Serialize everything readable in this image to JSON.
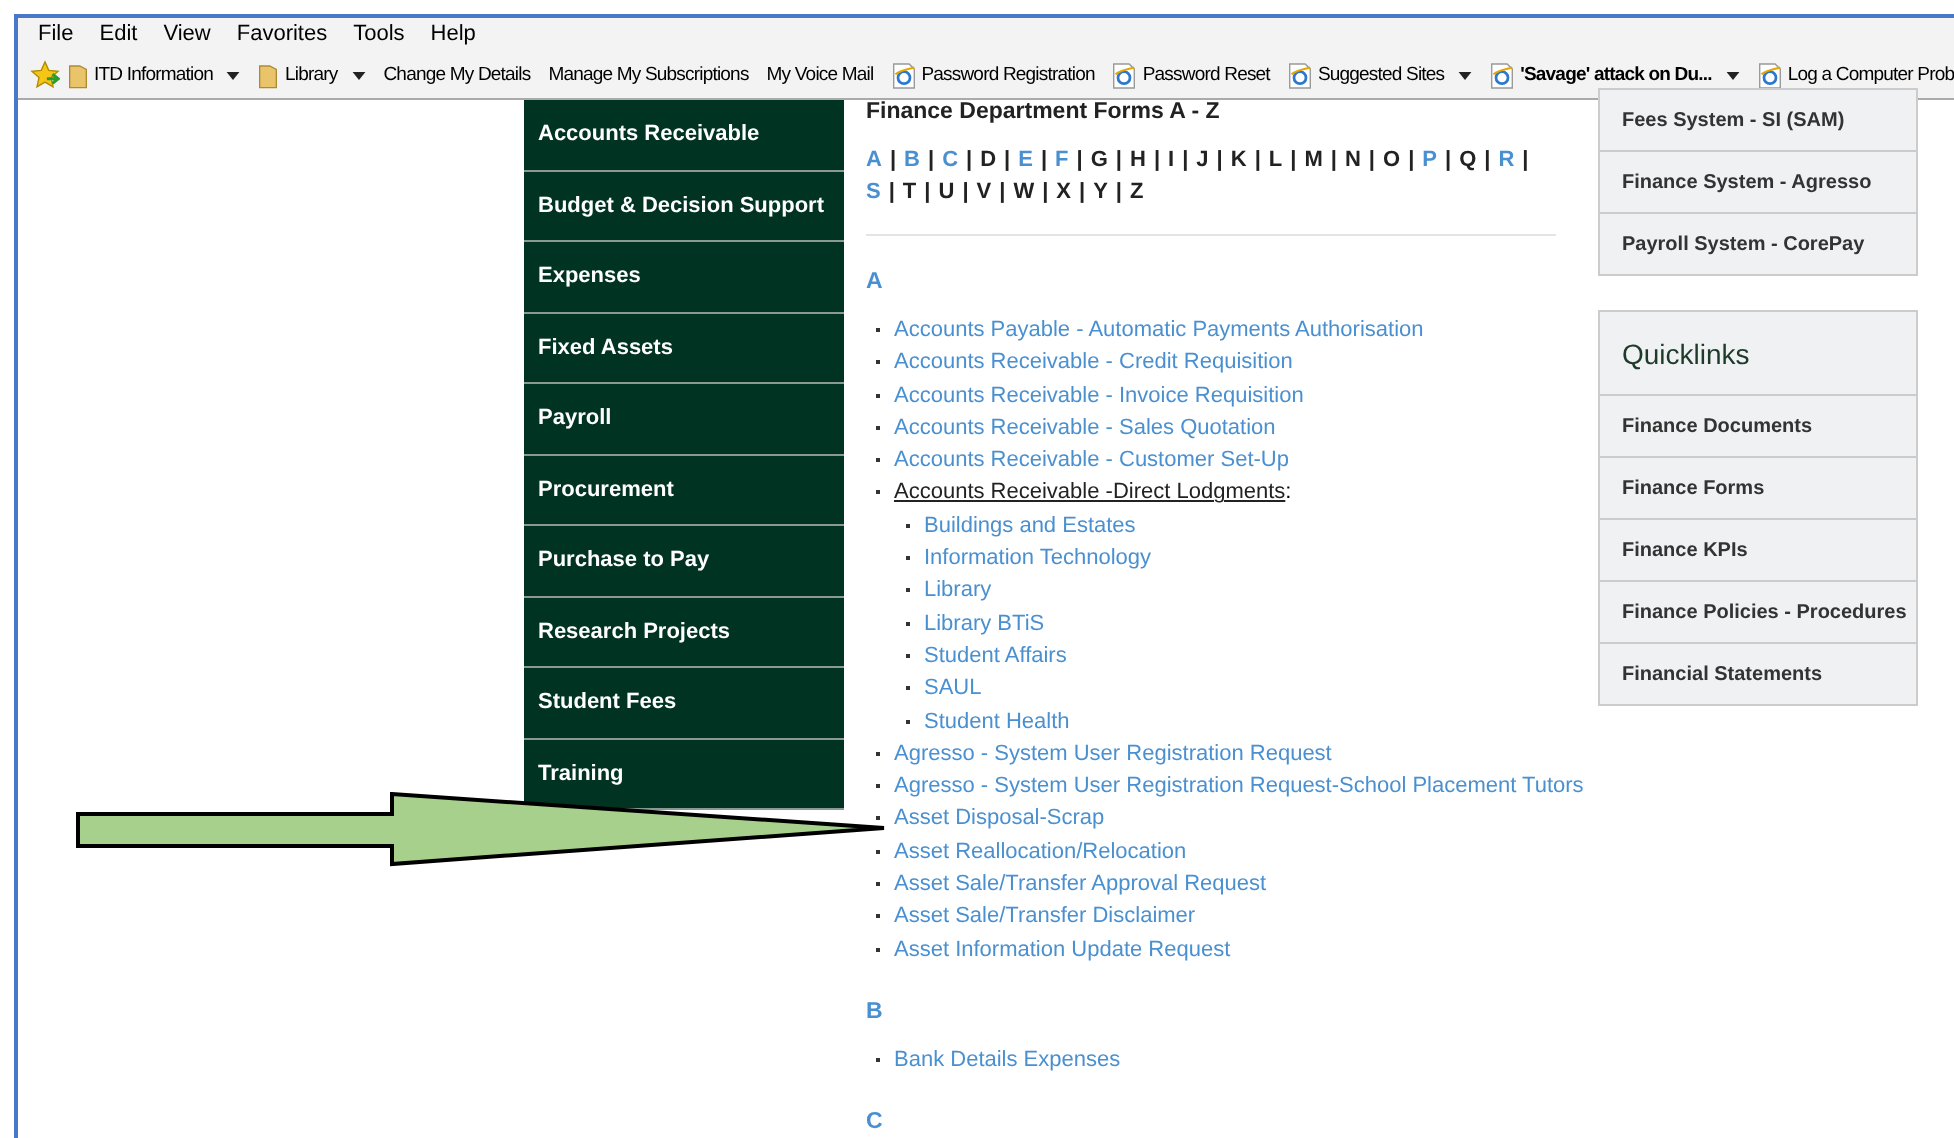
{
  "menu_bar": [
    "File",
    "Edit",
    "View",
    "Favorites",
    "Tools",
    "Help"
  ],
  "favorites_bar": [
    {
      "kind": "folder",
      "label": "ITD Information",
      "dropdown": true,
      "bold": false
    },
    {
      "kind": "folder",
      "label": "Library",
      "dropdown": true,
      "bold": false
    },
    {
      "kind": "plain",
      "label": "Change My Details",
      "dropdown": false,
      "bold": false
    },
    {
      "kind": "plain",
      "label": "Manage My Subscriptions",
      "dropdown": false,
      "bold": false
    },
    {
      "kind": "plain",
      "label": "My Voice Mail",
      "dropdown": false,
      "bold": false
    },
    {
      "kind": "page",
      "label": "Password Registration",
      "dropdown": false,
      "bold": false
    },
    {
      "kind": "page",
      "label": "Password Reset",
      "dropdown": false,
      "bold": false
    },
    {
      "kind": "page",
      "label": "Suggested Sites",
      "dropdown": true,
      "bold": false
    },
    {
      "kind": "page",
      "label": "'Savage' attack on Du...",
      "dropdown": true,
      "bold": true
    },
    {
      "kind": "page",
      "label": "Log a Computer Prob",
      "dropdown": false,
      "bold": false
    }
  ],
  "side_nav": [
    "Accounts Receivable",
    "Budget & Decision Support",
    "Expenses",
    "Fixed Assets",
    "Payroll",
    "Procurement",
    "Purchase to Pay",
    "Research Projects",
    "Student Fees",
    "Training"
  ],
  "content": {
    "heading": "Finance Department Forms A - Z",
    "alphabet": [
      {
        "letter": "A",
        "linked": true,
        "separator": "|"
      },
      {
        "letter": "B",
        "linked": true,
        "separator": "|"
      },
      {
        "letter": "C",
        "linked": true,
        "separator": "|"
      },
      {
        "letter": "D",
        "linked": false,
        "separator": "|"
      },
      {
        "letter": "E",
        "linked": true,
        "separator": "|"
      },
      {
        "letter": "F",
        "linked": true,
        "separator": "|"
      },
      {
        "letter": "G",
        "linked": false,
        "separator": "|"
      },
      {
        "letter": "H",
        "linked": false,
        "separator": "|"
      },
      {
        "letter": "I",
        "linked": false,
        "separator": "|"
      },
      {
        "letter": "J",
        "linked": false,
        "separator": "|"
      },
      {
        "letter": "K",
        "linked": false,
        "separator": "|"
      },
      {
        "letter": "L",
        "linked": false,
        "separator": "|"
      },
      {
        "letter": "M",
        "linked": false,
        "separator": "|"
      },
      {
        "letter": "N",
        "linked": false,
        "separator": "|"
      },
      {
        "letter": "O",
        "linked": false,
        "separator": "|"
      },
      {
        "letter": "P",
        "linked": true,
        "separator": "|"
      },
      {
        "letter": "Q",
        "linked": false,
        "separator": "|"
      },
      {
        "letter": "R",
        "linked": true,
        "separator": "|"
      },
      {
        "letter": "S",
        "linked": true,
        "separator": "|"
      },
      {
        "letter": "T",
        "linked": false,
        "separator": "|"
      },
      {
        "letter": "U",
        "linked": false,
        "separator": "|"
      },
      {
        "letter": "V",
        "linked": false,
        "separator": "|"
      },
      {
        "letter": "W",
        "linked": false,
        "separator": "|"
      },
      {
        "letter": "X",
        "linked": false,
        "separator": "|"
      },
      {
        "letter": "Y",
        "linked": false,
        "separator": "|"
      },
      {
        "letter": "Z",
        "linked": false
      }
    ],
    "sections": [
      {
        "letter": "A",
        "items": [
          {
            "label": "Accounts Payable - Automatic Payments Authorisation",
            "linked": true
          },
          {
            "label": "Accounts Receivable - Credit Requisition",
            "linked": true
          },
          {
            "label": "Accounts Receivable - Invoice Requisition",
            "linked": true
          },
          {
            "label": "Accounts Receivable - Sales Quotation",
            "linked": true
          },
          {
            "label": "Accounts Receivable - Customer Set-Up",
            "linked": true
          },
          {
            "label": "Accounts Receivable -Direct Lodgments",
            "linked": false,
            "suffix": ":",
            "children": [
              {
                "label": "Buildings and Estates",
                "linked": true
              },
              {
                "label": "Information Technology",
                "linked": true
              },
              {
                "label": "Library",
                "linked": true
              },
              {
                "label": "Library BTiS",
                "linked": true
              },
              {
                "label": "Student Affairs",
                "linked": true
              },
              {
                "label": "SAUL",
                "linked": true
              },
              {
                "label": "Student Health",
                "linked": true
              }
            ]
          },
          {
            "label": "Agresso - System User Registration Request",
            "linked": true
          },
          {
            "label": "Agresso - System User Registration Request-School Placement Tutors",
            "linked": true
          },
          {
            "label": "Asset Disposal-Scrap",
            "linked": true
          },
          {
            "label": "Asset Reallocation/Relocation",
            "linked": true
          },
          {
            "label": "Asset Sale/Transfer Approval Request",
            "linked": true
          },
          {
            "label": "Asset Sale/Transfer Disclaimer",
            "linked": true
          },
          {
            "label": "Asset Information Update Request",
            "linked": true
          }
        ]
      },
      {
        "letter": "B",
        "items": [
          {
            "label": "Bank Details Expenses",
            "linked": true
          }
        ]
      },
      {
        "letter": "C"
      }
    ]
  },
  "systems": [
    "Fees System - SI (SAM)",
    "Finance System - Agresso",
    "Payroll System - CorePay"
  ],
  "quicklinks": {
    "title": "Quicklinks",
    "items": [
      "Finance Documents",
      "Finance Forms",
      "Finance KPIs",
      "Finance Policies - Procedures",
      "Financial Statements"
    ]
  }
}
